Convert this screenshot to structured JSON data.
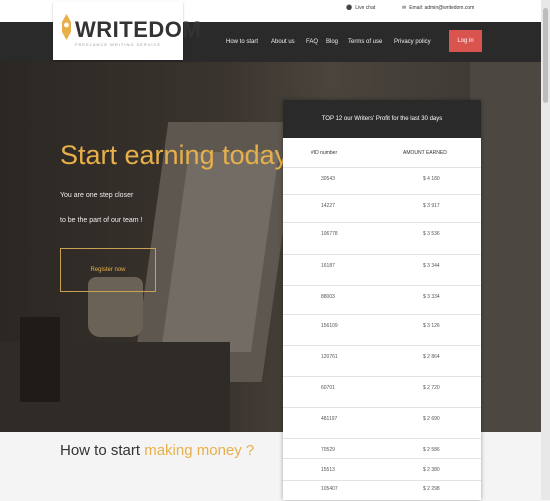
{
  "topbar": {
    "live_chat": "Live chat",
    "email": "Email: admin@writedom.com"
  },
  "logo": {
    "brand_part1": "WRITE",
    "brand_part2": "DOM",
    "tagline": "FREELANCE WRITING SERVICE"
  },
  "nav": {
    "items": [
      "How to start",
      "About us",
      "FAQ",
      "Blog",
      "Terms of use",
      "Privacy policy"
    ],
    "login": "Log in"
  },
  "hero": {
    "title": "Start earning today",
    "line1": "You are one step closer",
    "line2": "to be the part of our team !",
    "register": "Register now"
  },
  "table": {
    "title": "TOP 12 our Writers' Profit for the last 30 days",
    "col_id": "#ID number",
    "col_amount": "AMOUNT EARNED",
    "rows": [
      {
        "id": "30543",
        "amount": "$ 4 180"
      },
      {
        "id": "14227",
        "amount": "$ 3 917"
      },
      {
        "id": "106778",
        "amount": "$ 3 536"
      },
      {
        "id": "16187",
        "amount": "$ 3 344"
      },
      {
        "id": "88003",
        "amount": "$ 3 334"
      },
      {
        "id": "156109",
        "amount": "$ 3 126"
      },
      {
        "id": "120761",
        "amount": "$ 2 864"
      },
      {
        "id": "60701",
        "amount": "$ 2 720"
      },
      {
        "id": "481197",
        "amount": "$ 2 690"
      },
      {
        "id": "70529",
        "amount": "$ 2 586"
      },
      {
        "id": "15513",
        "amount": "$ 2 380"
      },
      {
        "id": "105407",
        "amount": "$ 2 298"
      }
    ]
  },
  "bottom": {
    "title_part1": "How to start",
    "title_part2": "making money ?"
  },
  "colors": {
    "accent": "#e8b04a",
    "login_bg": "#d9534f",
    "nav_bg": "#2a2a2a"
  }
}
